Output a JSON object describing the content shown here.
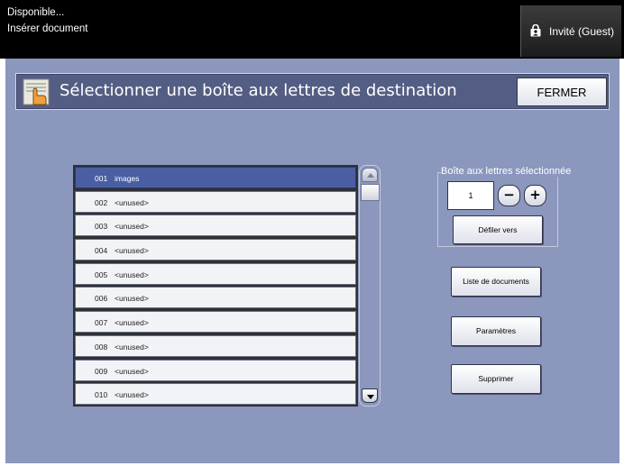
{
  "status": {
    "line1": "Disponible...",
    "line2": "Insérer document"
  },
  "user": {
    "label": "Invité (Guest)",
    "icon": "lock-user-icon"
  },
  "header": {
    "title": "Sélectionner une boîte aux lettres de destination",
    "close_label": "FERMER",
    "icon": "document-hand-icon"
  },
  "mailboxes": [
    {
      "num": "001",
      "name": "images",
      "selected": true
    },
    {
      "num": "002",
      "name": "<unused>",
      "selected": false
    },
    {
      "num": "003",
      "name": "<unused>",
      "selected": false
    },
    {
      "num": "004",
      "name": "<unused>",
      "selected": false
    },
    {
      "num": "005",
      "name": "<unused>",
      "selected": false
    },
    {
      "num": "006",
      "name": "<unused>",
      "selected": false
    },
    {
      "num": "007",
      "name": "<unused>",
      "selected": false
    },
    {
      "num": "008",
      "name": "<unused>",
      "selected": false
    },
    {
      "num": "009",
      "name": "<unused>",
      "selected": false
    },
    {
      "num": "010",
      "name": "<unused>",
      "selected": false
    }
  ],
  "selected_mailbox": {
    "label": "Boîte aux lettres sélectionnée",
    "value": "1",
    "minus": "−",
    "plus": "+",
    "goto_label": "Défiler vers"
  },
  "actions": {
    "documents_label": "Liste de documents",
    "params_label": "Paramètres",
    "delete_label": "Supprimer"
  },
  "colors": {
    "panel": "#8b97bd",
    "header": "#545e84",
    "selected_row": "#4a5fa3",
    "topbar": "#000000"
  }
}
